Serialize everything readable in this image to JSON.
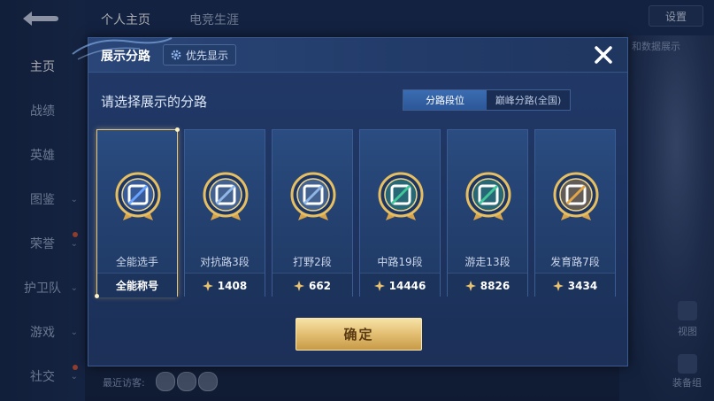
{
  "background": {
    "sidebar": [
      {
        "label": "主页",
        "active": true,
        "chevron": false,
        "dot": false
      },
      {
        "label": "战绩",
        "active": false,
        "chevron": false,
        "dot": false
      },
      {
        "label": "英雄",
        "active": false,
        "chevron": false,
        "dot": false
      },
      {
        "label": "图鉴",
        "active": false,
        "chevron": true,
        "dot": false
      },
      {
        "label": "荣誉",
        "active": false,
        "chevron": true,
        "dot": true
      },
      {
        "label": "护卫队",
        "active": false,
        "chevron": true,
        "dot": false
      },
      {
        "label": "游戏",
        "active": false,
        "chevron": true,
        "dot": false
      },
      {
        "label": "社交",
        "active": false,
        "chevron": true,
        "dot": true
      }
    ],
    "tabs": [
      "个人主页",
      "电竞生涯"
    ],
    "settings_label": "设置",
    "recent_label": "最近访客:",
    "right_label_1": "和数据展示",
    "right_label_2": "视图",
    "right_label_3": "装备组"
  },
  "dialog": {
    "title": "展示分路",
    "priority_label": "优先显示",
    "subtitle": "请选择展示的分路",
    "segments": [
      {
        "label": "分路段位",
        "active": true
      },
      {
        "label": "巅峰分路(全国)",
        "active": false
      }
    ],
    "cards": [
      {
        "name": "全能选手",
        "footer": "全能称号",
        "show_star": false,
        "icon": "all-round-badge-icon",
        "selected": true,
        "color": "#6aa3ff"
      },
      {
        "name": "对抗路3段",
        "footer": "1408",
        "show_star": true,
        "icon": "clash-lane-badge-icon",
        "selected": false,
        "color": "#8fb6e6"
      },
      {
        "name": "打野2段",
        "footer": "662",
        "show_star": true,
        "icon": "jungle-badge-icon",
        "selected": false,
        "color": "#8fb6e6"
      },
      {
        "name": "中路19段",
        "footer": "14446",
        "show_star": true,
        "icon": "mid-lane-badge-icon",
        "selected": false,
        "color": "#3fc79a"
      },
      {
        "name": "游走13段",
        "footer": "8826",
        "show_star": true,
        "icon": "roam-badge-icon",
        "selected": false,
        "color": "#3fc79a"
      },
      {
        "name": "发育路7段",
        "footer": "3434",
        "show_star": true,
        "icon": "farm-lane-badge-icon",
        "selected": false,
        "color": "#e2a548"
      }
    ],
    "confirm_label": "确定"
  }
}
